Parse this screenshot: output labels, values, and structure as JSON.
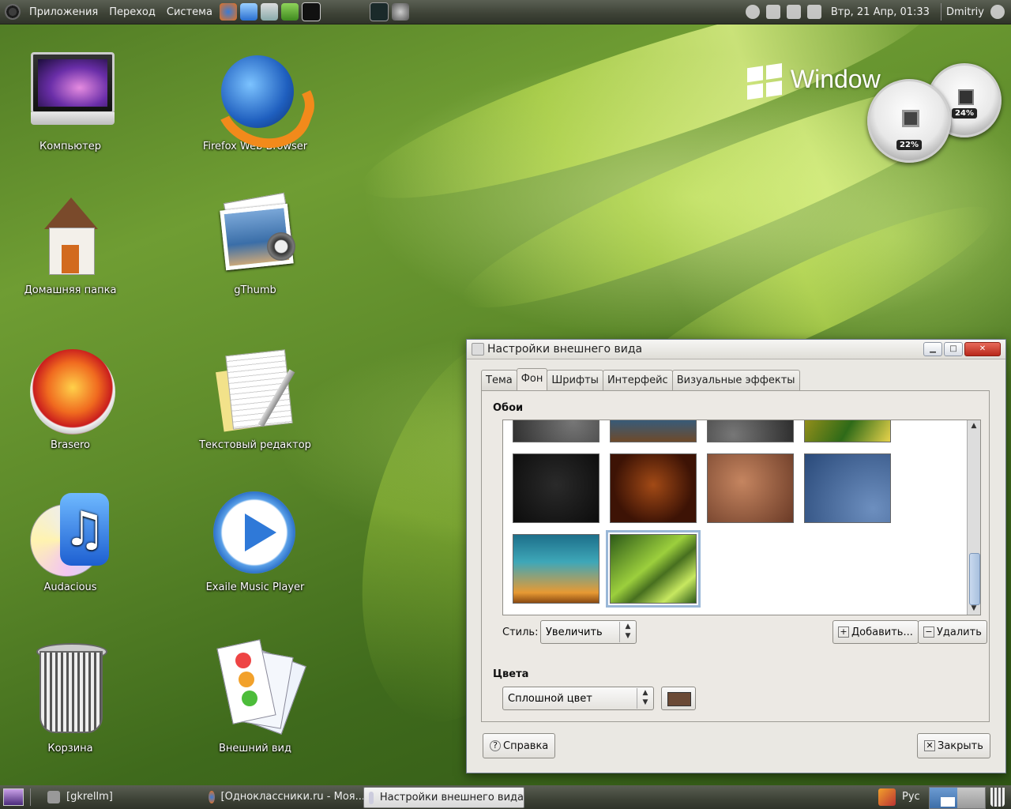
{
  "top_panel": {
    "menus": [
      "Приложения",
      "Переход",
      "Система"
    ],
    "datetime": "Втр, 21 Апр, 01:33",
    "user": "Dmitriy"
  },
  "desktop_icons": [
    {
      "label": "Компьютер"
    },
    {
      "label": "Firefox Web Browser"
    },
    {
      "label": "Домашняя папка"
    },
    {
      "label": "gThumb"
    },
    {
      "label": "Brasero"
    },
    {
      "label": "Текстовый редактор"
    },
    {
      "label": "Audacious"
    },
    {
      "label": "Exaile Music Player"
    },
    {
      "label": "Корзина"
    },
    {
      "label": "Внешний вид"
    }
  ],
  "gadget": {
    "logo_text": "Window",
    "cpu_percent": "22%",
    "mem_percent": "24%"
  },
  "dialog": {
    "title": "Настройки внешнего вида",
    "tabs": [
      "Тема",
      "Фон",
      "Шрифты",
      "Интерфейс",
      "Визуальные эффекты"
    ],
    "active_tab": "Фон",
    "wallpapers_heading": "Обои",
    "style_label": "Стиль:",
    "style_value": "Увеличить",
    "add_button": "Добавить...",
    "remove_button": "Удалить",
    "colors_heading": "Цвета",
    "color_mode": "Сплошной цвет",
    "color_swatch": "#6b4a36",
    "help_button": "Справка",
    "close_button": "Закрыть"
  },
  "taskbar": {
    "tasks": [
      "[gkrellm]",
      "[Одноклассники.ru - Моя...",
      "Настройки внешнего вида"
    ],
    "language": "Рус"
  }
}
